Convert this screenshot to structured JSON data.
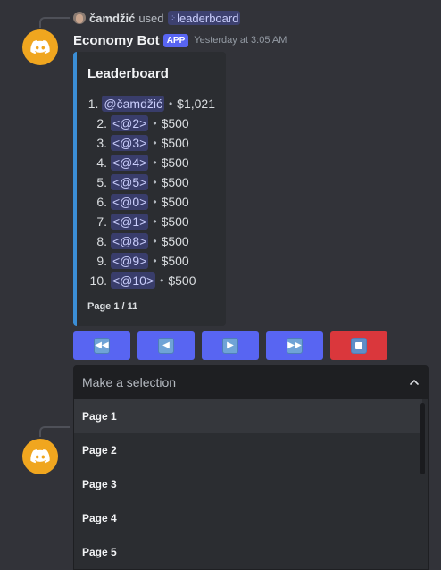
{
  "reply": {
    "user_name": "čamdžić",
    "used_text": "used",
    "command": "leaderboard",
    "command_icon": "slash-command-icon"
  },
  "message": {
    "bot_name": "Economy Bot",
    "badge": "APP",
    "timestamp": "Yesterday at 3:05 AM",
    "avatar_color": "#f0a61f"
  },
  "embed": {
    "title": "Leaderboard",
    "accent_color": "#3b8ed6",
    "entries": [
      {
        "rank": "1.",
        "user": "@čamdžić",
        "amount": "$1,021"
      },
      {
        "rank": "2.",
        "user": "<@2>",
        "amount": "$500"
      },
      {
        "rank": "3.",
        "user": "<@3>",
        "amount": "$500"
      },
      {
        "rank": "4.",
        "user": "<@4>",
        "amount": "$500"
      },
      {
        "rank": "5.",
        "user": "<@5>",
        "amount": "$500"
      },
      {
        "rank": "6.",
        "user": "<@0>",
        "amount": "$500"
      },
      {
        "rank": "7.",
        "user": "<@1>",
        "amount": "$500"
      },
      {
        "rank": "8.",
        "user": "<@8>",
        "amount": "$500"
      },
      {
        "rank": "9.",
        "user": "<@9>",
        "amount": "$500"
      },
      {
        "rank": "10.",
        "user": "<@10>",
        "amount": "$500"
      }
    ],
    "footer": "Page 1 / 11"
  },
  "buttons": [
    {
      "name": "first-page-button",
      "icon": "rewind-icon",
      "glyph": "◀◀",
      "color": "#5865f2"
    },
    {
      "name": "previous-page-button",
      "icon": "left-arrow-icon",
      "glyph": "◀",
      "color": "#5865f2"
    },
    {
      "name": "next-page-button",
      "icon": "play-icon",
      "glyph": "▶",
      "color": "#5865f2"
    },
    {
      "name": "last-page-button",
      "icon": "fast-forward-icon",
      "glyph": "▶▶",
      "color": "#5865f2"
    },
    {
      "name": "stop-button",
      "icon": "stop-icon",
      "glyph": "",
      "color": "#da373c"
    }
  ],
  "select": {
    "placeholder": "Make a selection",
    "options": [
      "Page 1",
      "Page 2",
      "Page 3",
      "Page 4",
      "Page 5"
    ]
  }
}
